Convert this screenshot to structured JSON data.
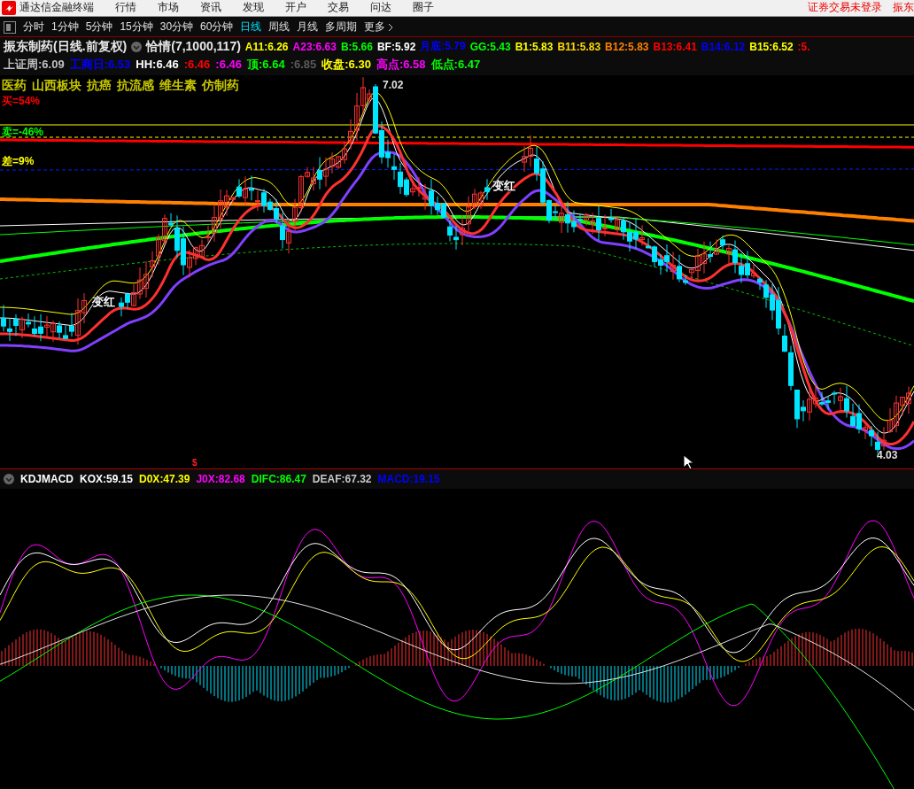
{
  "menu_bar": {
    "app_title": "通达信金融终端",
    "items": [
      "行情",
      "市场",
      "资讯",
      "发现",
      "开户",
      "交易",
      "问达",
      "圈子"
    ],
    "login_status": "证券交易未登录",
    "cut_title": "振东"
  },
  "period_tabs": [
    {
      "label": "分时",
      "selected": false
    },
    {
      "label": "1分钟",
      "selected": false
    },
    {
      "label": "5分钟",
      "selected": false
    },
    {
      "label": "15分钟",
      "selected": false
    },
    {
      "label": "30分钟",
      "selected": false
    },
    {
      "label": "60分钟",
      "selected": false
    },
    {
      "label": "日线",
      "selected": true
    },
    {
      "label": "周线",
      "selected": false
    },
    {
      "label": "月线",
      "selected": false
    },
    {
      "label": "多周期",
      "selected": false
    },
    {
      "label": "更多",
      "selected": false
    }
  ],
  "stock_header": {
    "title": "振东制药(日线.前复权)",
    "indicator": "恰情(7,1000,117)",
    "row_1": [
      {
        "text": "A11:6.26",
        "color": "#ffff00"
      },
      {
        "text": "A23:6.63",
        "color": "#ff00ff"
      },
      {
        "text": "B:5.66",
        "color": "#00ff00"
      },
      {
        "text": "BF:5.92",
        "color": "#ffffff"
      },
      {
        "text": "月底:5.79",
        "color": "#0000ff"
      },
      {
        "text": "GG:5.43",
        "color": "#00ff00"
      },
      {
        "text": "B1:5.83",
        "color": "#ffff00"
      },
      {
        "text": "B11:5.83",
        "color": "#ffd700"
      },
      {
        "text": "B12:5.83",
        "color": "#ff8000"
      },
      {
        "text": "B13:6.41",
        "color": "#ff0000"
      },
      {
        "text": "B14:6.12",
        "color": "#0000ff"
      },
      {
        "text": "B15:6.52",
        "color": "#ffff00"
      },
      {
        "text": ":5.",
        "color": "#ff0000"
      }
    ],
    "row_2": [
      {
        "text": "上证周:6.09",
        "color": "#c0c0c0"
      },
      {
        "text": "工商日:6.53",
        "color": "#0000ff"
      },
      {
        "text": "HH:6.46",
        "color": "#ffffff"
      },
      {
        "text": ":6.46",
        "color": "#ff0000"
      },
      {
        "text": ":6.46",
        "color": "#ff00ff"
      },
      {
        "text": "顶:6.64",
        "color": "#00ff00"
      },
      {
        "text": ":6.85",
        "color": "#5a5a5a"
      },
      {
        "text": "收盘:6.30",
        "color": "#ffff00"
      },
      {
        "text": "高点:6.58",
        "color": "#ff00ff"
      },
      {
        "text": "低点:6.47",
        "color": "#00ff00"
      }
    ]
  },
  "main_chart": {
    "sectors": [
      "医药",
      "山西板块",
      "抗癌",
      "抗流感",
      "维生素",
      "仿制药"
    ],
    "stats": [
      {
        "text": "买=54%",
        "color": "#ff0000"
      },
      {
        "text": "卖=-46%",
        "color": "#00ff00"
      },
      {
        "text": "差=9%",
        "color": "#ffff00"
      }
    ],
    "high_label": "7.02",
    "low_label": "4.03",
    "signals": [
      "变红",
      "变红"
    ],
    "marker": "$"
  },
  "indicator_panel": {
    "name": "KDJMACD",
    "values": [
      {
        "text": "KOX:59.15",
        "color": "#ffffff"
      },
      {
        "text": "D0X:47.39",
        "color": "#ffff00"
      },
      {
        "text": "J0X:82.68",
        "color": "#ff00ff"
      },
      {
        "text": "DIFC:86.47",
        "color": "#00ff00"
      },
      {
        "text": "DEAF:67.32",
        "color": "#c8c8c8"
      },
      {
        "text": "MACD:19.15",
        "color": "#0000ff"
      }
    ]
  }
}
